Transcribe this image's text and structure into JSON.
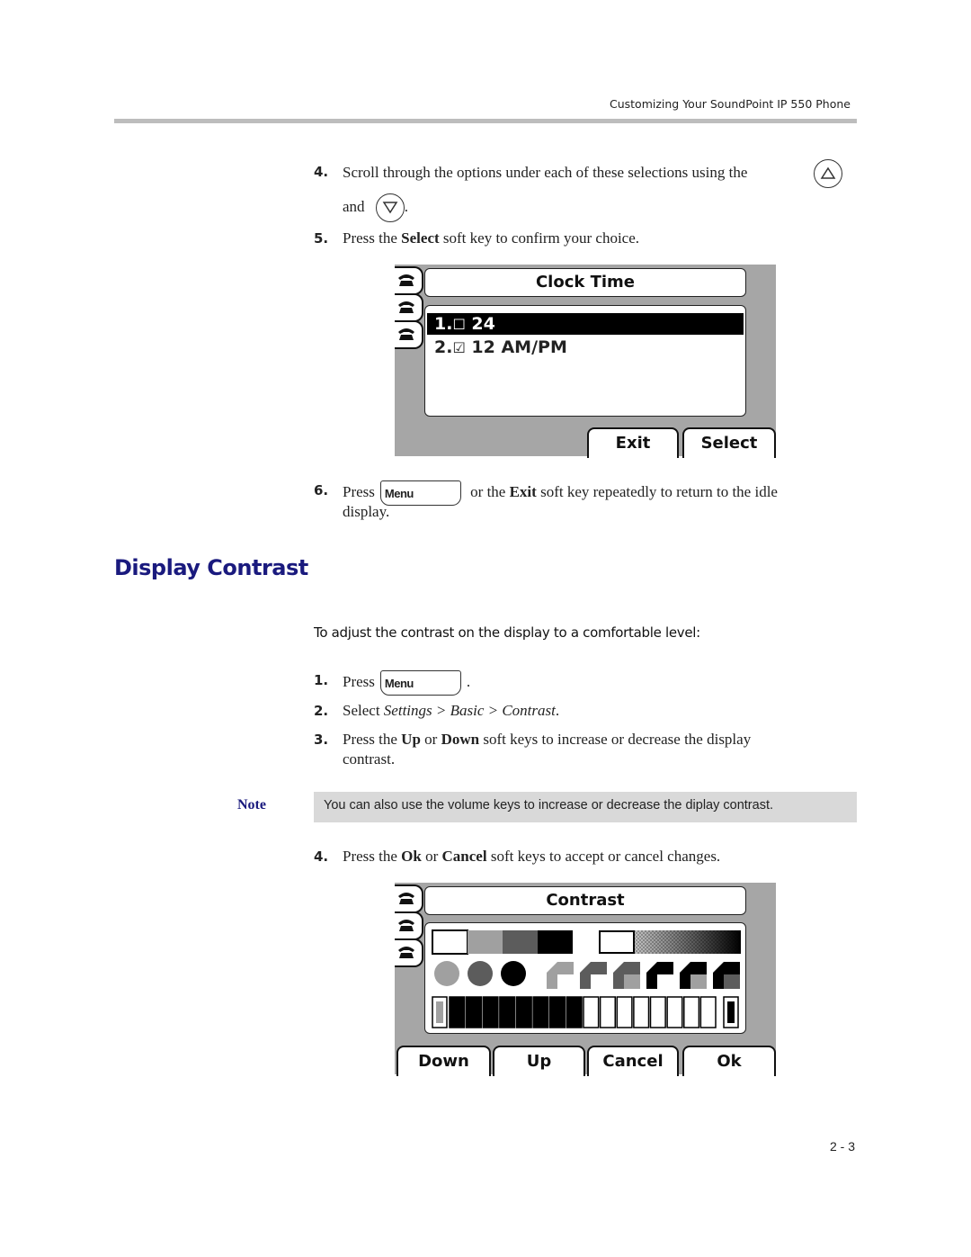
{
  "header": {
    "title": "Customizing Your SoundPoint IP 550 Phone"
  },
  "steps_a": [
    {
      "num": "4.",
      "text_before": "Scroll through the options under each of these selections using the",
      "text_and": "and",
      "text_after": "."
    },
    {
      "num": "5.",
      "text_pre": "Press the ",
      "bold": "Select",
      "text_post": " soft key to confirm your choice."
    }
  ],
  "icons": {
    "up": "up-arrow-key-icon",
    "down": "down-arrow-key-icon",
    "menu": "menu-key-icon"
  },
  "screen1": {
    "title": "Clock Time",
    "items": [
      {
        "label": "1.",
        "check": "☐",
        "text": "24",
        "selected": true
      },
      {
        "label": "2.",
        "check": "☑",
        "text": "12 AM/PM",
        "selected": false
      }
    ],
    "softkeys": [
      "Exit",
      "Select"
    ]
  },
  "step6": {
    "num": "6.",
    "pre": "Press",
    "menu": "Menu",
    "mid": " or the ",
    "bold": "Exit",
    "post": " soft key repeatedly to return to the idle",
    "line2": "display."
  },
  "section": {
    "title": "Display Contrast",
    "procedure": "To adjust the contrast on the display to a comfortable level:"
  },
  "steps_b": [
    {
      "num": "1.",
      "pre": "Press",
      "menu": "Menu",
      "post": "."
    },
    {
      "num": "2.",
      "pre": "Select ",
      "path": "Settings > Basic > Contrast",
      "post": "."
    },
    {
      "num": "3.",
      "pre": "Press the ",
      "b1": "Up",
      "mid": " or ",
      "b2": "Down",
      "post": " soft keys to increase or decrease the display",
      "line2": "contrast."
    }
  ],
  "note": {
    "label": "Note",
    "text": "You can also use the volume keys to increase or decrease the diplay contrast."
  },
  "step4b": {
    "num": "4.",
    "pre": "Press the ",
    "b1": "Ok",
    "mid": " or ",
    "b2": "Cancel",
    "post": " soft keys to accept or cancel changes."
  },
  "screen2": {
    "title": "Contrast",
    "contrast_level": {
      "filled_segments": 8,
      "total_segments": 16,
      "percent": 50
    },
    "swatch_colors": [
      "#ffffff",
      "#a0a0a0",
      "#5c5c5c",
      "#000000"
    ],
    "softkeys": [
      "Down",
      "Up",
      "Cancel",
      "Ok"
    ]
  },
  "page": {
    "number": "2 - 3"
  }
}
